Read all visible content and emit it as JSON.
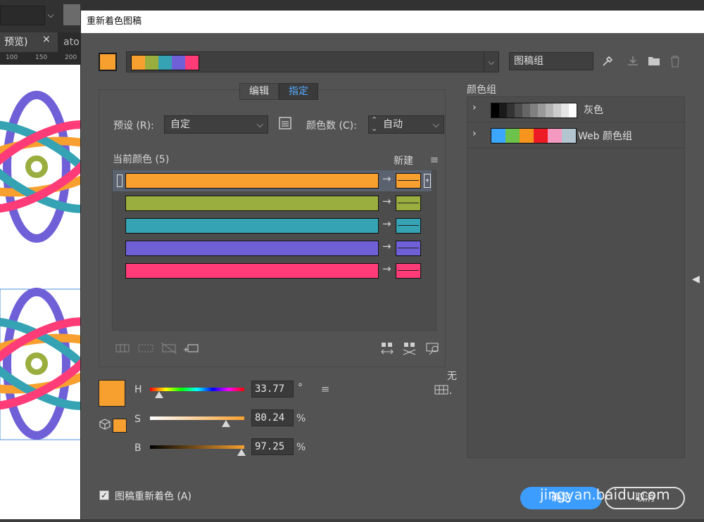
{
  "background": {
    "tab_label": "预览)",
    "tab_close": "×",
    "next_tab": "ato",
    "ruler_ticks": [
      "100",
      "150",
      "200"
    ]
  },
  "dialog": {
    "title": "重新着色图稿",
    "group_name_placeholder": "图稿组",
    "palette_colors": [
      "#f7a030",
      "#9aad3f",
      "#35a3b4",
      "#7060d8",
      "#ff3c78"
    ],
    "tabs": {
      "edit": "编辑",
      "assign": "指定"
    },
    "preset_label": "预设 (R):",
    "preset_value": "自定",
    "colors_label": "颜色数 (C):",
    "colors_value": "自动",
    "current_colors_label": "当前颜色 (5)",
    "new_label": "新建",
    "color_rows": [
      {
        "current": "#f7a030",
        "new": "#f7a030"
      },
      {
        "current": "#9aad3f",
        "new": "#9aad3f"
      },
      {
        "current": "#35a3b4",
        "new": "#35a3b4"
      },
      {
        "current": "#7060d8",
        "new": "#7060d8"
      },
      {
        "current": "#ff3c78",
        "new": "#ff3c78"
      }
    ],
    "hsb": {
      "h_label": "H",
      "h_value": "33.77",
      "h_unit": "°",
      "s_label": "S",
      "s_value": "80.24",
      "s_unit": "%",
      "b_label": "B",
      "b_value": "97.25",
      "b_unit": "%",
      "h_fraction": 0.094,
      "s_fraction": 0.8024,
      "b_fraction": 0.9725
    },
    "none_label": "无",
    "recolor_checkbox": "图稿重新着色 (A)",
    "recolor_checked": true,
    "ok_label": "确定",
    "cancel_label": "取消",
    "watermark": "jingyan.baidu.com",
    "color_groups_title": "颜色组",
    "color_groups": [
      {
        "name": "灰色",
        "swatches": [
          "#000000",
          "#1a1a1a",
          "#333333",
          "#4d4d4d",
          "#666666",
          "#808080",
          "#999999",
          "#b3b3b3",
          "#cccccc",
          "#e6e6e6",
          "#ffffff"
        ]
      },
      {
        "name": "Web 颜色组",
        "swatches": [
          "#3ba6ff",
          "#6cc24a",
          "#f7941d",
          "#ed1c24",
          "#f49ac1",
          "#b3c5d1"
        ]
      }
    ]
  }
}
